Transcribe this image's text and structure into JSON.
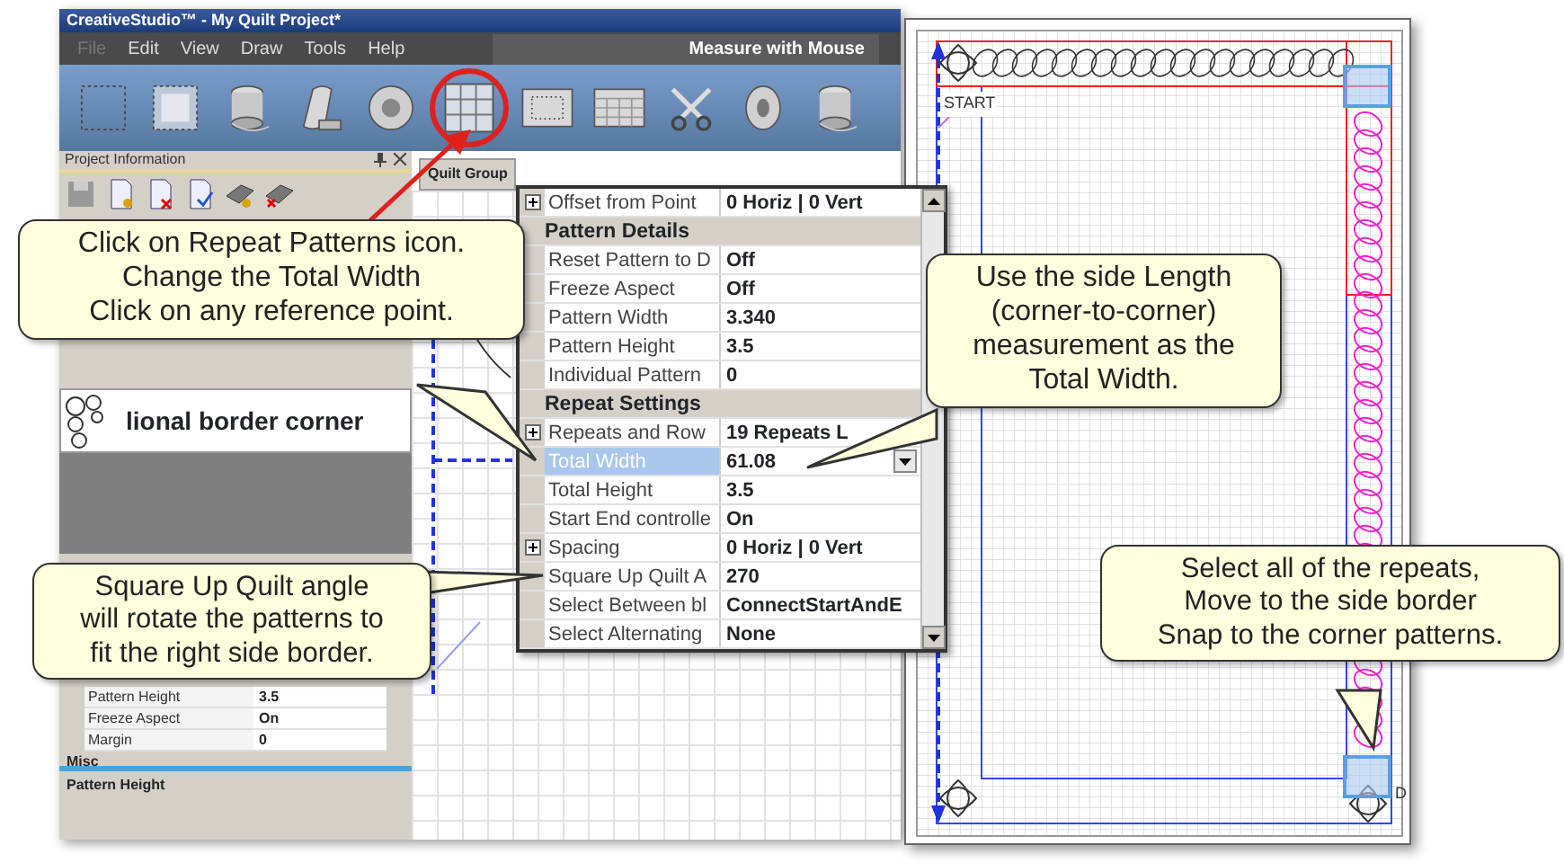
{
  "window": {
    "title": "CreativeStudio™ - My Quilt Project*"
  },
  "menu": [
    {
      "label": "File",
      "disabled": true
    },
    {
      "label": "Edit",
      "disabled": false
    },
    {
      "label": "View",
      "disabled": false
    },
    {
      "label": "Draw",
      "disabled": false
    },
    {
      "label": "Tools",
      "disabled": false
    },
    {
      "label": "Help",
      "disabled": false
    }
  ],
  "mode_label": "Measure with Mouse",
  "toolbar": [
    {
      "kind": "dashed-square",
      "circled": false
    },
    {
      "kind": "square",
      "circled": false
    },
    {
      "kind": "spool",
      "circled": false
    },
    {
      "kind": "scroll",
      "circled": false
    },
    {
      "kind": "ring",
      "circled": false
    },
    {
      "kind": "grid",
      "circled": true
    },
    {
      "kind": "dotted-grid",
      "circled": false
    },
    {
      "kind": "calendar-grid",
      "circled": false
    },
    {
      "kind": "scissors",
      "circled": false
    },
    {
      "kind": "roll",
      "circled": false
    },
    {
      "kind": "spool",
      "circled": false
    }
  ],
  "project_panel": {
    "title": "Project Information",
    "pattern_name": "lional border corner"
  },
  "details_panel": {
    "rows": [
      {
        "name": "Pattern Height",
        "value": "3.5"
      },
      {
        "name": "Freeze Aspect",
        "value": "On"
      },
      {
        "name": "Margin",
        "value": "0"
      }
    ],
    "group": "Misc",
    "description": "Pattern Height"
  },
  "quilt_tab": "Quilt Group",
  "property_grid": {
    "rows": [
      {
        "kind": "property",
        "name": "Offset from Point",
        "value": "0 Horiz | 0 Vert",
        "expandable": true,
        "selected": false,
        "dropdown": false
      },
      {
        "kind": "group",
        "name": "Pattern Details"
      },
      {
        "kind": "property",
        "name": "Reset Pattern to D",
        "value": "Off",
        "expandable": false,
        "selected": false,
        "dropdown": false
      },
      {
        "kind": "property",
        "name": "Freeze Aspect",
        "value": "Off",
        "expandable": false,
        "selected": false,
        "dropdown": false
      },
      {
        "kind": "property",
        "name": "Pattern Width",
        "value": "3.340",
        "expandable": false,
        "selected": false,
        "dropdown": false
      },
      {
        "kind": "property",
        "name": "Pattern Height",
        "value": "3.5",
        "expandable": false,
        "selected": false,
        "dropdown": false
      },
      {
        "kind": "property",
        "name": "Individual Pattern",
        "value": "0",
        "expandable": false,
        "selected": false,
        "dropdown": false
      },
      {
        "kind": "group",
        "name": "Repeat Settings"
      },
      {
        "kind": "property",
        "name": "Repeats and Row",
        "value": "19 Repeats L",
        "expandable": true,
        "selected": false,
        "dropdown": false
      },
      {
        "kind": "property",
        "name": "Total Width",
        "value": "61.08",
        "expandable": false,
        "selected": true,
        "dropdown": true
      },
      {
        "kind": "property",
        "name": "Total Height",
        "value": "3.5",
        "expandable": false,
        "selected": false,
        "dropdown": false
      },
      {
        "kind": "property",
        "name": "Start End controlle",
        "value": "On",
        "expandable": false,
        "selected": false,
        "dropdown": false
      },
      {
        "kind": "property",
        "name": "Spacing",
        "value": "0 Horiz | 0 Vert",
        "expandable": true,
        "selected": false,
        "dropdown": false
      },
      {
        "kind": "property",
        "name": "Square Up Quilt A",
        "value": "270",
        "expandable": false,
        "selected": false,
        "dropdown": false
      },
      {
        "kind": "property",
        "name": "Select Between bl",
        "value": "ConnectStartAndE",
        "expandable": false,
        "selected": false,
        "dropdown": false
      },
      {
        "kind": "property",
        "name": "Select Alternating",
        "value": "None",
        "expandable": false,
        "selected": false,
        "dropdown": false
      }
    ]
  },
  "layout": {
    "start_label": "START",
    "end_label": "D"
  },
  "callouts": [
    {
      "text": "Click on Repeat Patterns icon.\nChange the Total Width\nClick on any reference point."
    },
    {
      "text": "Use the side Length\n(corner-to-corner)\nmeasurement as the\nTotal Width."
    },
    {
      "text": "Square Up Quilt angle\nwill rotate the patterns to\nfit the right side border."
    },
    {
      "text": "Select all of the repeats,\nMove to the side border\nSnap to the corner patterns."
    }
  ]
}
